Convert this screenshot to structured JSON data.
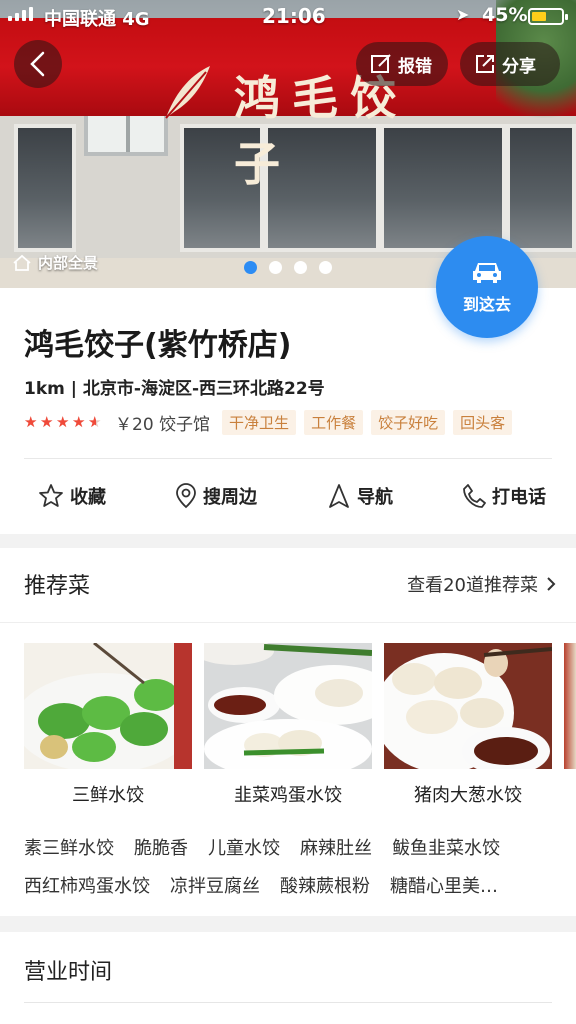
{
  "status_bar": {
    "carrier": "中国联通",
    "network": "4G",
    "time": "21:06",
    "battery": "45%",
    "battery_level": 0.45
  },
  "hero": {
    "sign_text": "鸿毛饺子",
    "report_label": "报错",
    "share_label": "分享",
    "panorama_label": "内部全景",
    "carousel": {
      "count": 4,
      "active_index": 0
    }
  },
  "goto_button": {
    "label": "到这去"
  },
  "place": {
    "name": "鸿毛饺子(紫竹桥店)",
    "address": "1km | 北京市-海淀区-西三环北路22号",
    "rating": 4.5,
    "rating_max": 5,
    "price_category": "￥20 饺子馆",
    "tags": [
      "干净卫生",
      "工作餐",
      "饺子好吃",
      "回头客"
    ]
  },
  "actions": {
    "favorite": "收藏",
    "search_nearby": "搜周边",
    "navigate": "导航",
    "call": "打电话"
  },
  "recommended": {
    "title": "推荐菜",
    "more": "查看20道推荐菜",
    "dishes": [
      {
        "name": "三鲜水饺"
      },
      {
        "name": "韭菜鸡蛋水饺"
      },
      {
        "name": "猪肉大葱水饺"
      }
    ],
    "more_dishes_row1": [
      "素三鲜水饺",
      "脆脆香",
      "儿童水饺",
      "麻辣肚丝",
      "鲅鱼韭菜水饺"
    ],
    "more_dishes_row2": [
      "西红柿鸡蛋水饺",
      "凉拌豆腐丝",
      "酸辣蕨根粉",
      "糖醋心里美…"
    ]
  },
  "hours": {
    "title": "营业时间"
  },
  "colors": {
    "accent": "#2d8cf0",
    "star": "#f04a3a",
    "tag_bg": "#fbf1e6",
    "tag_text": "#c9803c",
    "sign_red": "#c40d12"
  }
}
